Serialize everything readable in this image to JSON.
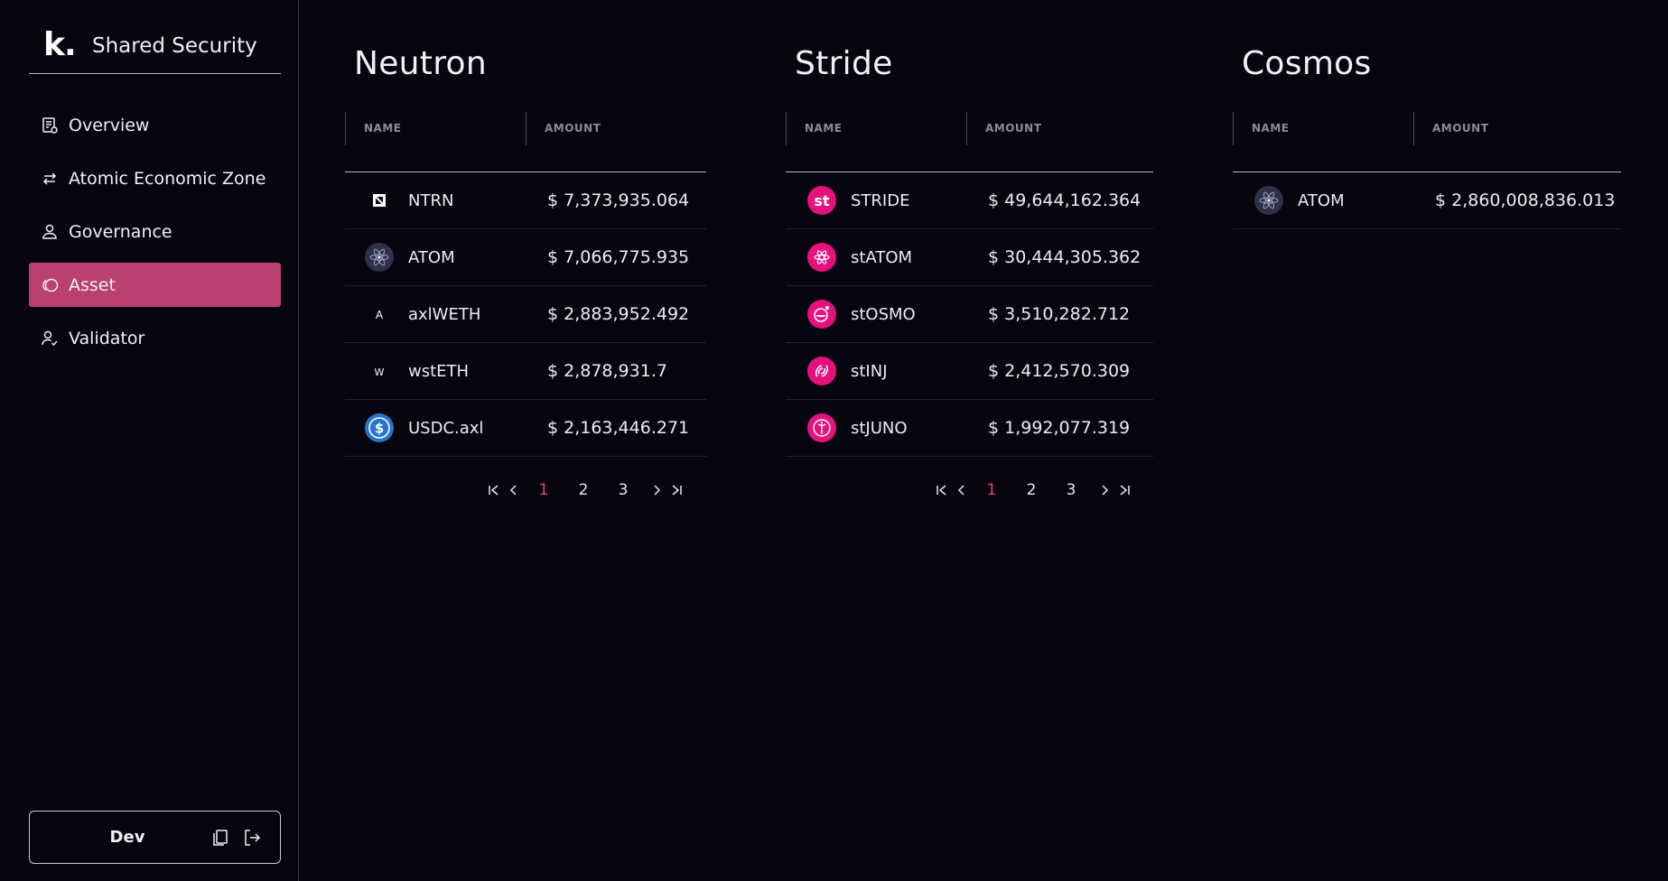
{
  "sidebar": {
    "brand_logo": "k.",
    "brand_title": "Shared Security",
    "items": [
      {
        "label": "Overview",
        "icon": "report-icon"
      },
      {
        "label": "Atomic Economic Zone",
        "icon": "arrows-exchange-icon"
      },
      {
        "label": "Governance",
        "icon": "person-icon"
      },
      {
        "label": "Asset",
        "icon": "coins-icon",
        "active": true
      },
      {
        "label": "Validator",
        "icon": "user-check-icon"
      }
    ],
    "account": {
      "label": "Dev",
      "copy_icon": "copy-icon",
      "logout_icon": "logout-icon"
    }
  },
  "columns": {
    "name": "NAME",
    "amount": "AMOUNT"
  },
  "panels": [
    {
      "title": "Neutron",
      "rows": [
        {
          "name": "NTRN",
          "amount": "$ 7,373,935.064",
          "icon": "ntrn-icon"
        },
        {
          "name": "ATOM",
          "amount": "$ 7,066,775.935",
          "icon": "atom-icon"
        },
        {
          "name": "axlWETH",
          "amount": "$ 2,883,952.492",
          "icon": "axlweth-icon"
        },
        {
          "name": "wstETH",
          "amount": "$ 2,878,931.7",
          "icon": "wsteth-icon"
        },
        {
          "name": "USDC.axl",
          "amount": "$ 2,163,446.271",
          "icon": "usdc-icon"
        }
      ],
      "pager": {
        "pages": [
          "1",
          "2",
          "3"
        ],
        "current": "1"
      }
    },
    {
      "title": "Stride",
      "rows": [
        {
          "name": "STRIDE",
          "amount": "$ 49,644,162.364",
          "icon": "stride-icon"
        },
        {
          "name": "stATOM",
          "amount": "$ 30,444,305.362",
          "icon": "statom-icon"
        },
        {
          "name": "stOSMO",
          "amount": "$ 3,510,282.712",
          "icon": "stosmo-icon"
        },
        {
          "name": "stINJ",
          "amount": "$ 2,412,570.309",
          "icon": "stinj-icon"
        },
        {
          "name": "stJUNO",
          "amount": "$ 1,992,077.319",
          "icon": "stjuno-icon"
        }
      ],
      "pager": {
        "pages": [
          "1",
          "2",
          "3"
        ],
        "current": "1"
      }
    },
    {
      "title": "Cosmos",
      "rows": [
        {
          "name": "ATOM",
          "amount": "$ 2,860,008,836.013",
          "icon": "atom-icon"
        }
      ]
    }
  ],
  "colors": {
    "accent": "#b9406f",
    "stride_pink": "#e5127d",
    "page_current": "#e0457f",
    "background": "#07050f"
  }
}
